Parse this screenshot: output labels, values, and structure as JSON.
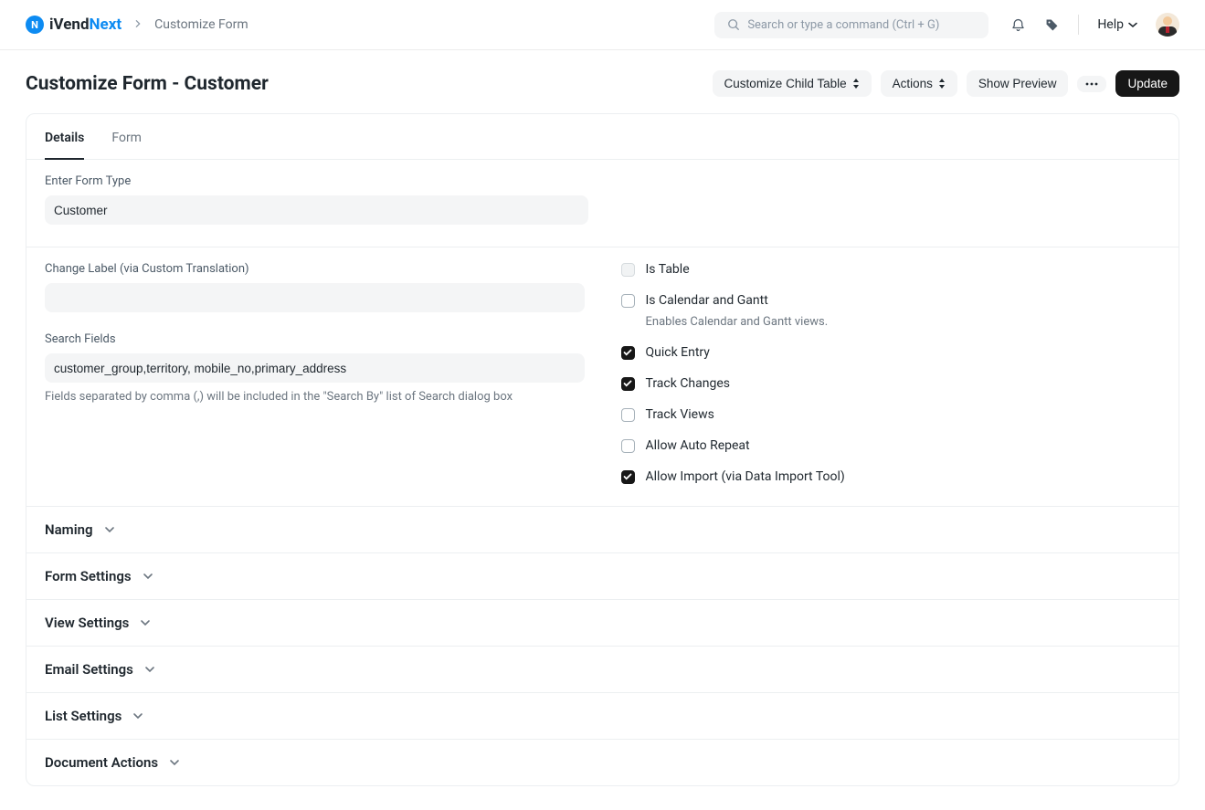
{
  "brand": {
    "part1": "iVend",
    "part2": "Next"
  },
  "breadcrumb": "Customize Form",
  "search": {
    "placeholder": "Search or type a command (Ctrl + G)"
  },
  "help_label": "Help",
  "page_title": "Customize Form - Customer",
  "buttons": {
    "customize_child_table": "Customize Child Table",
    "actions": "Actions",
    "show_preview": "Show Preview",
    "update": "Update"
  },
  "tabs": {
    "details": "Details",
    "form": "Form"
  },
  "fields": {
    "enter_form_type_label": "Enter Form Type",
    "enter_form_type_value": "Customer",
    "change_label_label": "Change Label (via Custom Translation)",
    "change_label_value": "",
    "search_fields_label": "Search Fields",
    "search_fields_value": "customer_group,territory, mobile_no,primary_address",
    "search_fields_help": "Fields separated by comma (,) will be included in the \"Search By\" list of Search dialog box"
  },
  "checkboxes": {
    "is_table": "Is Table",
    "is_calendar_gantt": "Is Calendar and Gantt",
    "is_calendar_gantt_help": "Enables Calendar and Gantt views.",
    "quick_entry": "Quick Entry",
    "track_changes": "Track Changes",
    "track_views": "Track Views",
    "allow_auto_repeat": "Allow Auto Repeat",
    "allow_import": "Allow Import (via Data Import Tool)"
  },
  "accordions": {
    "naming": "Naming",
    "form_settings": "Form Settings",
    "view_settings": "View Settings",
    "email_settings": "Email Settings",
    "list_settings": "List Settings",
    "document_actions": "Document Actions"
  }
}
